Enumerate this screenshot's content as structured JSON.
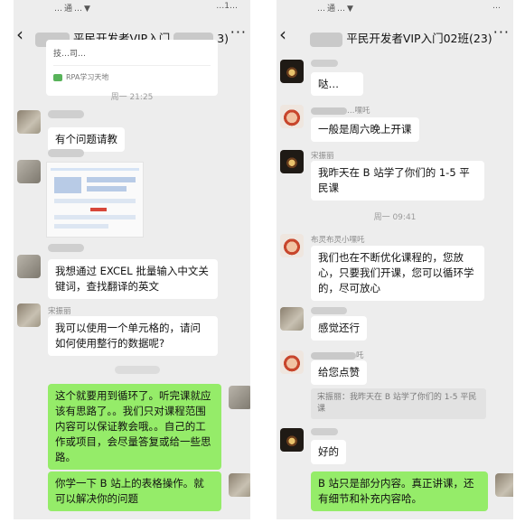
{
  "left_chat": {
    "status_text": "…通…▼",
    "status_time": "…1…",
    "title": "平民开发者VIP入门",
    "title_suffix": "3)",
    "card": {
      "subtitle": "技…司…",
      "source": "RPA学习天地"
    },
    "timestamp": "周一 21:25",
    "messages": [
      {
        "text": "有个问题请教"
      },
      {
        "text": "我想通过 EXCEL 批量输入中文关键词，查找翻译的英文"
      },
      {
        "nick": "宋振丽",
        "text": "我可以使用一个单元格的，请问如何使用整行的数据呢?"
      },
      {
        "text": "这个就要用到循环了。听完课就应该有思路了。。我们只对课程范围内容可以保证教会哦。。自己的工作或项目，会尽量答复或给一些思路。"
      },
      {
        "text": "你学一下 B 站上的表格操作。就可以解决你的问题"
      }
    ]
  },
  "right_chat": {
    "status_text": "…通…▼",
    "status_time": "…",
    "title": "平民开发者VIP入门02班(23)",
    "timestamp": "周一 09:41",
    "messages": [
      {
        "text": "哒…"
      },
      {
        "nick": "…嘿吒",
        "text": "一般是周六晚上开课"
      },
      {
        "nick": "宋振丽",
        "text": "我昨天在 B 站学了你们的 1-5 平民课"
      },
      {
        "nick": "布灵布灵小嘿吒",
        "text": "我们也在不断优化课程的，您放心，只要我们开课，您可以循环学的，尽可放心"
      },
      {
        "text": "感觉还行"
      },
      {
        "nick": "吒",
        "text": "给您点赞"
      },
      {
        "quote": "宋振丽：我昨天在 B 站学了你们的 1-5 平民课"
      },
      {
        "text": "好的"
      },
      {
        "text": "B 站只是部分内容。真正讲课，还有细节和补充内容哈。"
      }
    ]
  },
  "colors": {
    "chat_bg": "#ededed",
    "bubble_white": "#ffffff",
    "bubble_green": "#95ec69",
    "timestamp": "#9a9a9a"
  },
  "icons": [
    "back-chevron-icon",
    "more-dots-icon",
    "rpa-source-icon"
  ]
}
